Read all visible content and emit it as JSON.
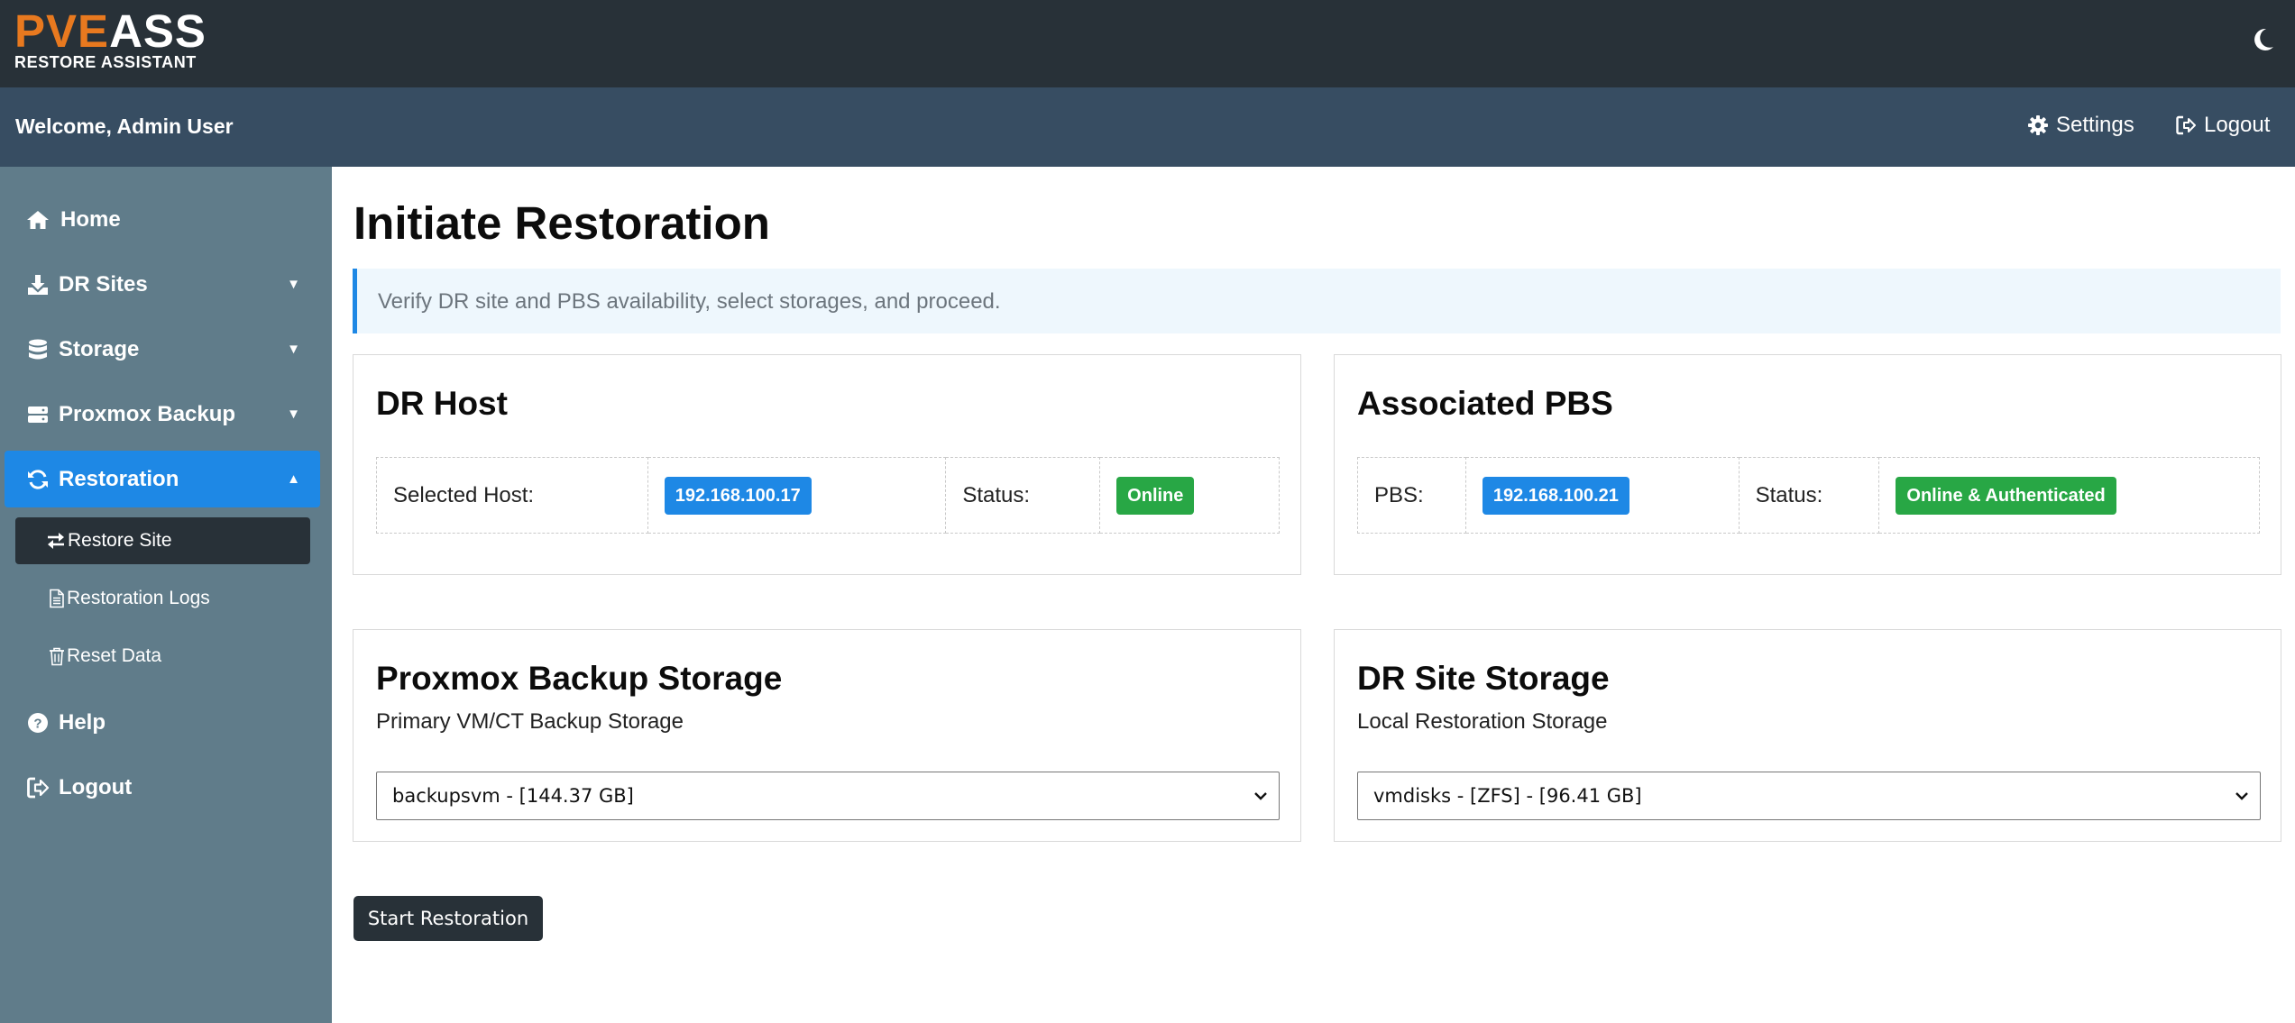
{
  "brand": {
    "logo_part1": "PVE",
    "logo_part2": "ASS",
    "logo_subtitle": "RESTORE ASSISTANT"
  },
  "header": {
    "welcome": "Welcome, Admin User",
    "settings_label": "Settings",
    "logout_label": "Logout"
  },
  "sidebar": {
    "items": [
      {
        "label": "Home",
        "icon": "home-icon"
      },
      {
        "label": "DR Sites",
        "icon": "download-icon",
        "caret": "▼"
      },
      {
        "label": "Storage",
        "icon": "database-icon",
        "caret": "▼"
      },
      {
        "label": "Proxmox Backup",
        "icon": "server-icon",
        "caret": "▼"
      },
      {
        "label": "Restoration",
        "icon": "sync-icon",
        "caret": "▲",
        "active": true
      },
      {
        "label": "Help",
        "icon": "question-circle-icon"
      },
      {
        "label": "Logout",
        "icon": "sign-out-icon"
      }
    ],
    "subitems": [
      {
        "label": "Restore Site",
        "icon": "exchange-icon",
        "active": true
      },
      {
        "label": "Restoration Logs",
        "icon": "file-icon"
      },
      {
        "label": "Reset Data",
        "icon": "trash-icon"
      }
    ]
  },
  "main": {
    "title": "Initiate Restoration",
    "info": "Verify DR site and PBS availability, select storages, and proceed.",
    "dr_host": {
      "title": "DR Host",
      "host_label": "Selected Host:",
      "host_value": "192.168.100.17",
      "status_label": "Status:",
      "status_value": "Online"
    },
    "pbs": {
      "title": "Associated PBS",
      "pbs_label": "PBS:",
      "pbs_value": "192.168.100.21",
      "status_label": "Status:",
      "status_value": "Online & Authenticated"
    },
    "backup_storage": {
      "title": "Proxmox Backup Storage",
      "subtitle": "Primary VM/CT Backup Storage",
      "selected": "backupsvm - [144.37 GB]"
    },
    "dr_storage": {
      "title": "DR Site Storage",
      "subtitle": "Local Restoration Storage",
      "selected": "vmdisks - [ZFS] - [96.41 GB]"
    },
    "start_button": "Start Restoration"
  },
  "colors": {
    "topbar": "#283138",
    "subbar": "#374d62",
    "sidebar": "#607c8a",
    "accent": "#1e88e5",
    "success": "#28a745",
    "logo_orange": "#e8791f"
  }
}
